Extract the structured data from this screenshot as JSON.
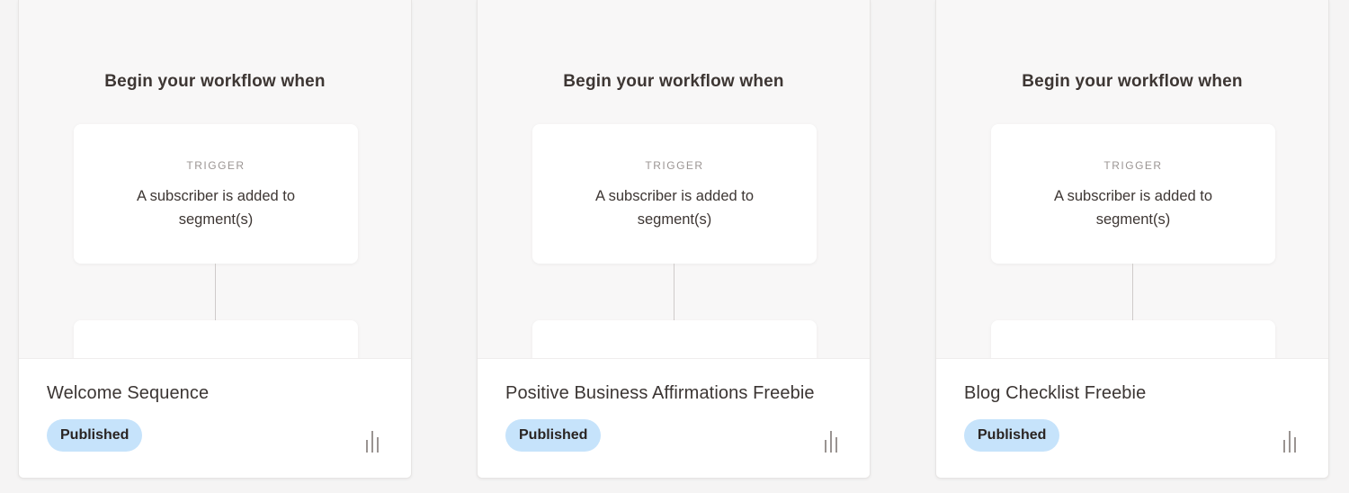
{
  "workflows": [
    {
      "heading": "Begin your workflow when",
      "trigger_label": "TRIGGER",
      "trigger_text": "A subscriber is added to segment(s)",
      "name": "Welcome Sequence",
      "status": "Published",
      "stats_icon": "bar-chart-icon"
    },
    {
      "heading": "Begin your workflow when",
      "trigger_label": "TRIGGER",
      "trigger_text": "A subscriber is added to segment(s)",
      "name": "Positive Business Affirmations Freebie",
      "status": "Published",
      "stats_icon": "bar-chart-icon"
    },
    {
      "heading": "Begin your workflow when",
      "trigger_label": "TRIGGER",
      "trigger_text": "A subscriber is added to segment(s)",
      "name": "Blog Checklist Freebie",
      "status": "Published",
      "stats_icon": "bar-chart-icon"
    }
  ],
  "colors": {
    "page_bg": "#f5f4f4",
    "card_bg": "#f8f7f7",
    "badge_bg": "#c6e3fb",
    "text": "#3b3533",
    "muted": "#9b9593",
    "icon": "#9a9492"
  }
}
